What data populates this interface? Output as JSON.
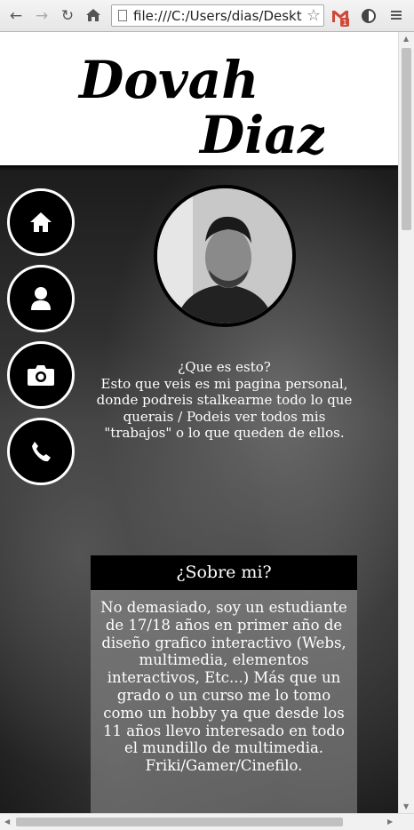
{
  "browser": {
    "url": "file:///C:/Users/dias/Deskto",
    "gmail_badge": "1"
  },
  "header": {
    "logo_line1": "Dovah",
    "logo_line2": "Diaz"
  },
  "sidebar": {
    "items": [
      {
        "name": "home",
        "icon": "home-icon"
      },
      {
        "name": "profile",
        "icon": "user-icon"
      },
      {
        "name": "gallery",
        "icon": "camera-icon"
      },
      {
        "name": "contact",
        "icon": "phone-icon"
      }
    ]
  },
  "intro": {
    "question": "¿Que es esto?",
    "text": "Esto que veis es mi pagina personal, donde podreis stalkearme todo lo que querais / Podeis ver todos mis \"trabajos\" o lo que queden de ellos."
  },
  "about": {
    "title": "¿Sobre mi?",
    "text": "No demasiado, soy un estudiante de 17/18 años en primer año de diseño grafico interactivo (Webs, multimedia, elementos interactivos, Etc...) Más que un grado o un curso me lo tomo como un hobby ya que desde los 11 años llevo interesado en todo el mundillo de multimedia. Friki/Gamer/Cinefilo."
  },
  "colors": {
    "accent": "#000000",
    "gmail_red": "#d14836"
  }
}
